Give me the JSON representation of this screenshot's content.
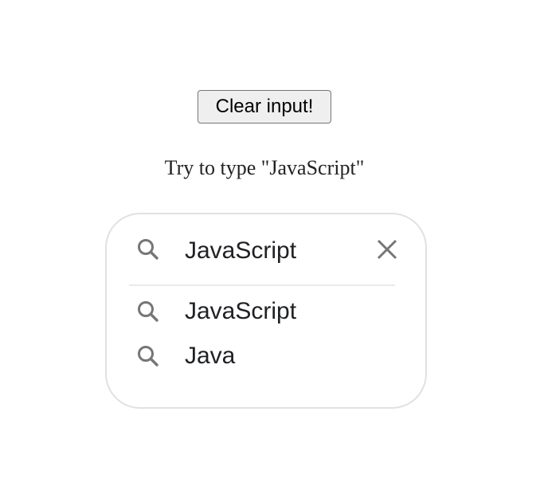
{
  "clear_button": {
    "label": "Clear input!"
  },
  "hint": {
    "text": "Try to type \"JavaScript\""
  },
  "search": {
    "value": "JavaScript",
    "icon": "search-icon",
    "clear_icon": "close-icon"
  },
  "suggestions": [
    {
      "label": "JavaScript",
      "icon": "search-icon"
    },
    {
      "label": "Java",
      "icon": "search-icon"
    }
  ],
  "colors": {
    "icon": "#767676",
    "text": "#202124",
    "border": "#dfe1e5"
  }
}
